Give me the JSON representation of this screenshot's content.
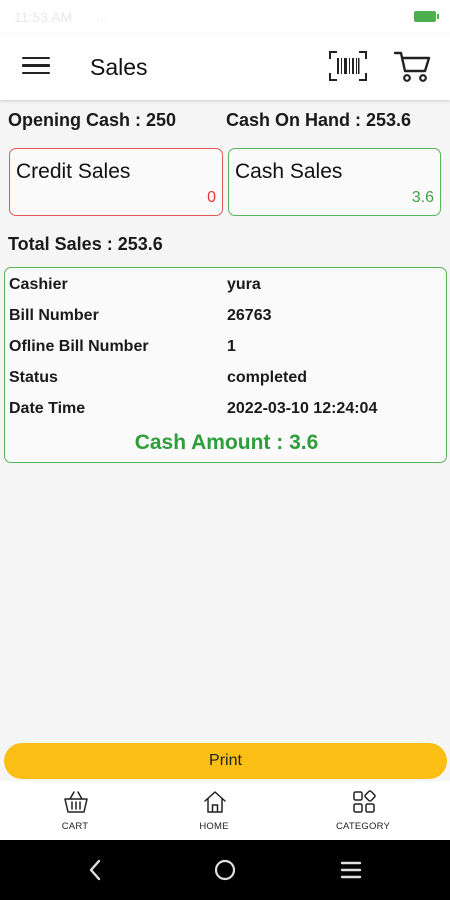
{
  "status_bar": {
    "time": "11:53 AM",
    "extra": "..."
  },
  "app_bar": {
    "title": "Sales",
    "icons": [
      "menu-icon",
      "barcode-icon",
      "cart-icon"
    ]
  },
  "summary": {
    "opening_cash": "Opening Cash : 250",
    "cash_on_hand": "Cash On Hand : 253.6",
    "total_sales": "Total Sales : 253.6"
  },
  "cards": {
    "credit": {
      "title": "Credit Sales",
      "value": "0"
    },
    "cash": {
      "title": "Cash Sales",
      "value": "3.6"
    }
  },
  "details": {
    "rows": [
      {
        "label": "Cashier",
        "value": "yura"
      },
      {
        "label": "Bill Number",
        "value": "26763"
      },
      {
        "label": "Ofline Bill Number",
        "value": "1"
      },
      {
        "label": "Status",
        "value": "completed"
      },
      {
        "label": "Date Time",
        "value": "2022-03-10 12:24:04"
      }
    ],
    "cash_amount": "Cash Amount : 3.6"
  },
  "print_button": {
    "label": "Print"
  },
  "bottom_nav": [
    {
      "label": "CART",
      "icon": "basket-icon"
    },
    {
      "label": "HOME",
      "icon": "home-icon"
    },
    {
      "label": "CATEGORY",
      "icon": "category-icon"
    }
  ],
  "colors": {
    "accent": "#fbbe15",
    "credit_red": "#e53935",
    "cash_green": "#43a047",
    "amount_green": "#2e9d3a"
  }
}
